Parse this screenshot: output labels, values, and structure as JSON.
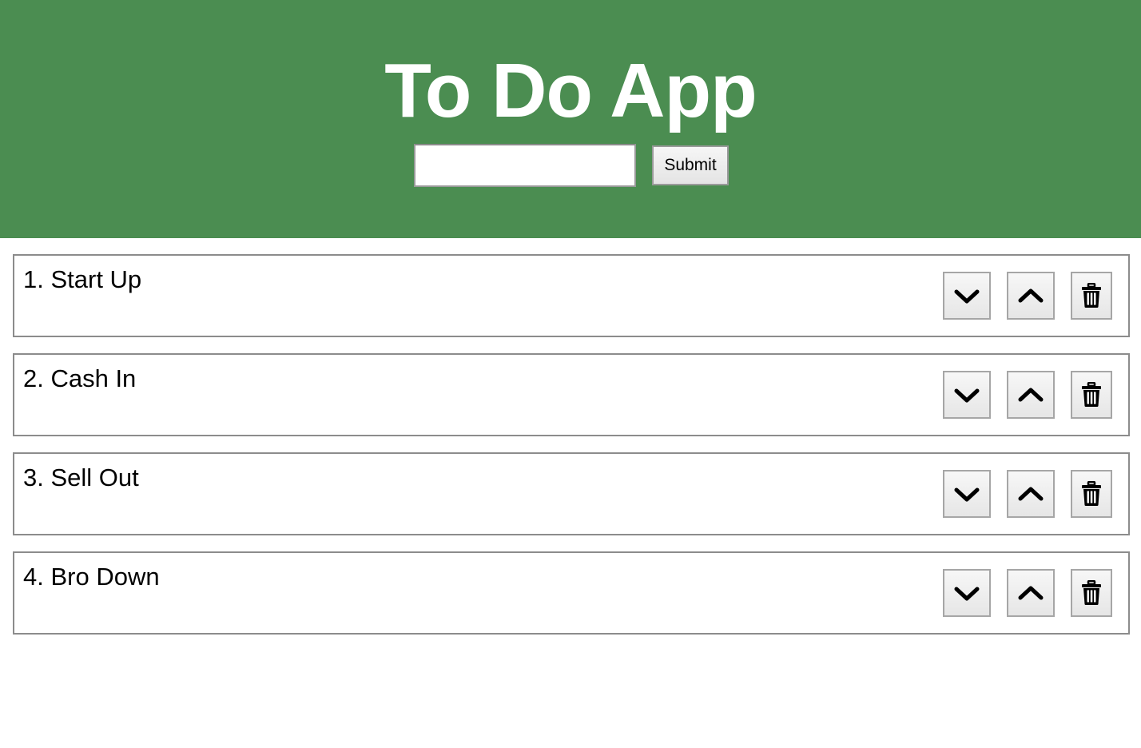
{
  "header": {
    "title": "To Do App",
    "input": {
      "value": "",
      "placeholder": ""
    },
    "submit_label": "Submit",
    "background_color": "#4b8d51"
  },
  "todos": [
    {
      "text": "1. Start Up"
    },
    {
      "text": "2. Cash In"
    },
    {
      "text": "3. Sell Out"
    },
    {
      "text": "4. Bro Down"
    }
  ],
  "item_actions": {
    "move_down_icon": "chevron-down-icon",
    "move_up_icon": "chevron-up-icon",
    "delete_icon": "trash-icon"
  }
}
